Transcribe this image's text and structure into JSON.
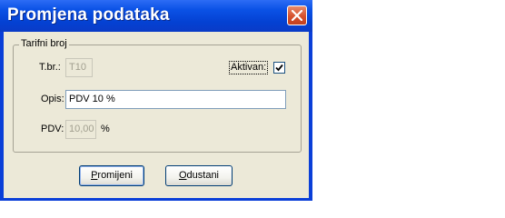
{
  "window": {
    "title": "Promjena podataka",
    "close_icon": "close-icon"
  },
  "group": {
    "legend": "Tarifni broj",
    "tbr_label": "T.br.:",
    "tbr_value": "T10",
    "active_label": "Aktivan:",
    "active_checked": true,
    "opis_label": "Opis:",
    "opis_value": "PDV 10 %",
    "pdv_label": "PDV:",
    "pdv_value": "10,00",
    "pdv_unit": "%"
  },
  "buttons": {
    "confirm_first": "P",
    "confirm_rest": "romijeni",
    "cancel_first": "O",
    "cancel_rest": "dustani"
  },
  "colors": {
    "title_bar": "#0b52e6",
    "close_button": "#d6512d",
    "dialog_face": "#ece9d8"
  }
}
